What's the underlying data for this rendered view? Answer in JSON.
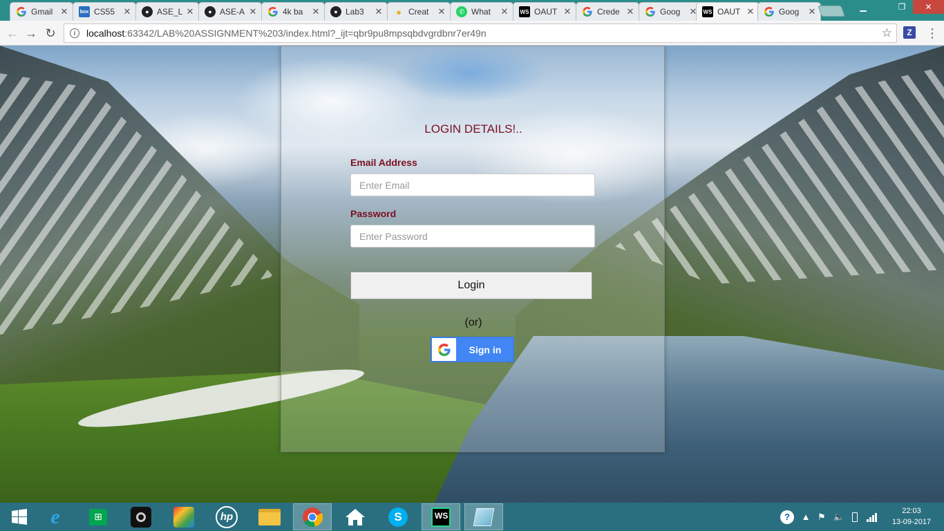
{
  "browser": {
    "tabs": [
      {
        "title": "Gmail",
        "icon": "google-g-icon"
      },
      {
        "title": "CS55",
        "icon": "box-icon"
      },
      {
        "title": "ASE_L",
        "icon": "github-icon"
      },
      {
        "title": "ASE-A",
        "icon": "github-icon"
      },
      {
        "title": "4k ba",
        "icon": "google-g-icon"
      },
      {
        "title": "Lab3",
        "icon": "github-icon"
      },
      {
        "title": "Creat",
        "icon": "bulb-icon"
      },
      {
        "title": "What",
        "icon": "whatsapp-icon"
      },
      {
        "title": "OAUT",
        "icon": "webstorm-icon"
      },
      {
        "title": "Crede",
        "icon": "google-g-icon"
      },
      {
        "title": "Goog",
        "icon": "google-g-icon"
      },
      {
        "title": "OAUT",
        "icon": "webstorm-icon"
      },
      {
        "title": "Goog",
        "icon": "google-g-icon"
      }
    ],
    "active_tab": 11,
    "url_host": "localhost",
    "url_rest": ":63342/LAB%20ASSIGNMENT%203/index.html?_ijt=qbr9pu8mpsqbdvgrdbnr7er49n",
    "extension_label": "Z"
  },
  "login": {
    "title": "LOGIN DETAILS!..",
    "email_label": "Email Address",
    "email_placeholder": "Enter Email",
    "password_label": "Password",
    "password_placeholder": "Enter Password",
    "login_button": "Login",
    "or_text": "(or)",
    "google_button": "Sign in"
  },
  "taskbar": {
    "clock_time": "22:03",
    "clock_date": "13-09-2017",
    "apps": [
      "start-icon",
      "internet-explorer-icon",
      "store-icon",
      "camera-app-icon",
      "puzzle-app-icon",
      "hp-icon",
      "file-explorer-icon",
      "chrome-icon",
      "home-icon",
      "skype-icon",
      "webstorm-icon",
      "notepad-icon"
    ]
  },
  "colors": {
    "accent_dark_red": "#7a1020",
    "google_blue": "#4285f4",
    "taskbar": "#2a6f80",
    "tabstrip": "#2b8d8a"
  }
}
